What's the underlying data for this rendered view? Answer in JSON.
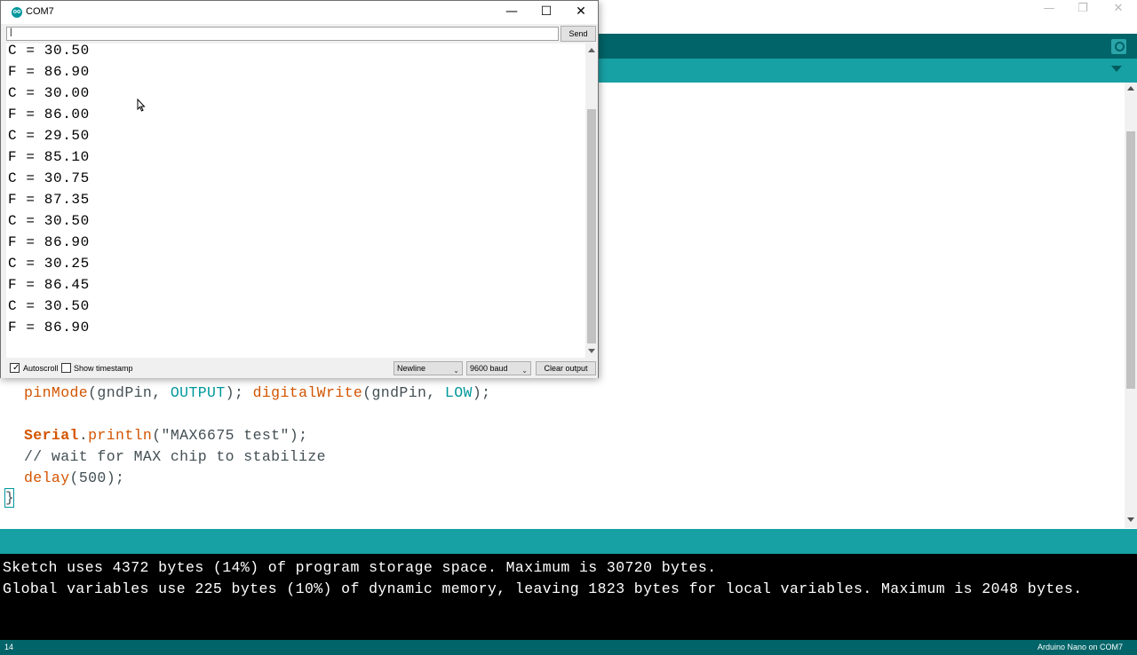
{
  "ide": {
    "window_controls": {
      "minimize": "—",
      "restore": "❐",
      "close": "✕"
    },
    "code_lines": [
      {
        "segments": [
          {
            "text": "pinMode",
            "cls": "kw-orange"
          },
          {
            "text": "(gndPin, ",
            "cls": ""
          },
          {
            "text": "OUTPUT",
            "cls": "kw-teal"
          },
          {
            "text": "); ",
            "cls": ""
          },
          {
            "text": "digitalWrite",
            "cls": "kw-orange"
          },
          {
            "text": "(gndPin, ",
            "cls": ""
          },
          {
            "text": "LOW",
            "cls": "kw-teal"
          },
          {
            "text": ");",
            "cls": ""
          }
        ]
      },
      {
        "segments": []
      },
      {
        "segments": [
          {
            "text": "Serial",
            "cls": "kw-bold"
          },
          {
            "text": ".",
            "cls": ""
          },
          {
            "text": "println",
            "cls": "kw-orange"
          },
          {
            "text": "(\"MAX6675 test\");",
            "cls": ""
          }
        ]
      },
      {
        "segments": [
          {
            "text": "// wait for MAX chip to stabilize",
            "cls": ""
          }
        ]
      },
      {
        "segments": [
          {
            "text": "delay",
            "cls": "kw-orange"
          },
          {
            "text": "(500);",
            "cls": ""
          }
        ]
      }
    ],
    "closing_brace": "}",
    "console_lines": [
      "Sketch uses 4372 bytes (14%) of program storage space. Maximum is 30720 bytes.",
      "Global variables use 225 bytes (10%) of dynamic memory, leaving 1823 bytes for local variables. Maximum is 2048 bytes."
    ],
    "line_number": "14",
    "board_info": "Arduino Nano on COM7",
    "colors": {
      "toolbar": "#006468",
      "tabs": "#17a1a5",
      "console": "#000000"
    }
  },
  "serial_monitor": {
    "title": "COM7",
    "app_icon": "oo",
    "window_controls": {
      "minimize": "—",
      "maximize": "☐",
      "close": "✕"
    },
    "input_value": "|",
    "send_label": "Send",
    "output_lines": [
      "C = 30.50",
      "F = 86.90",
      "C = 30.00",
      "F = 86.00",
      "C = 29.50",
      "F = 85.10",
      "C = 30.75",
      "F = 87.35",
      "C = 30.50",
      "F = 86.90",
      "C = 30.25",
      "F = 86.45",
      "C = 30.50",
      "F = 86.90"
    ],
    "autoscroll_label": "Autoscroll",
    "autoscroll_checked": "✓",
    "timestamp_label": "Show timestamp",
    "line_ending": "Newline",
    "baud_rate": "9600 baud",
    "clear_label": "Clear output",
    "dropdown_arrow": "⌄"
  }
}
